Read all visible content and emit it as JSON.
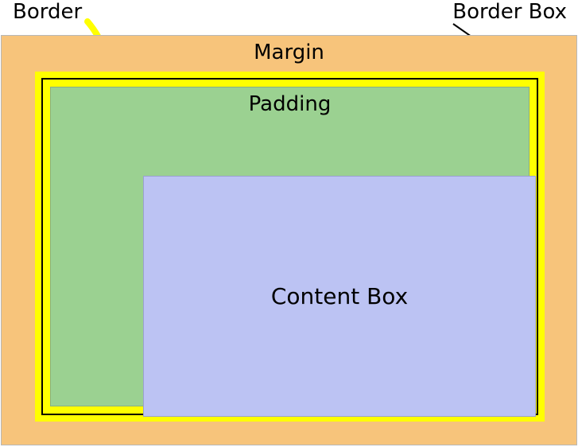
{
  "labels": {
    "border": "Border",
    "borderbox": "Border Box",
    "margin": "Margin",
    "padding": "Padding",
    "content": "Content Box"
  },
  "colors": {
    "margin": "#f7c47b",
    "border": "#ffff00",
    "borderbox_line": "#000000",
    "padding": "#9bd191",
    "content": "#bcc3f3"
  }
}
